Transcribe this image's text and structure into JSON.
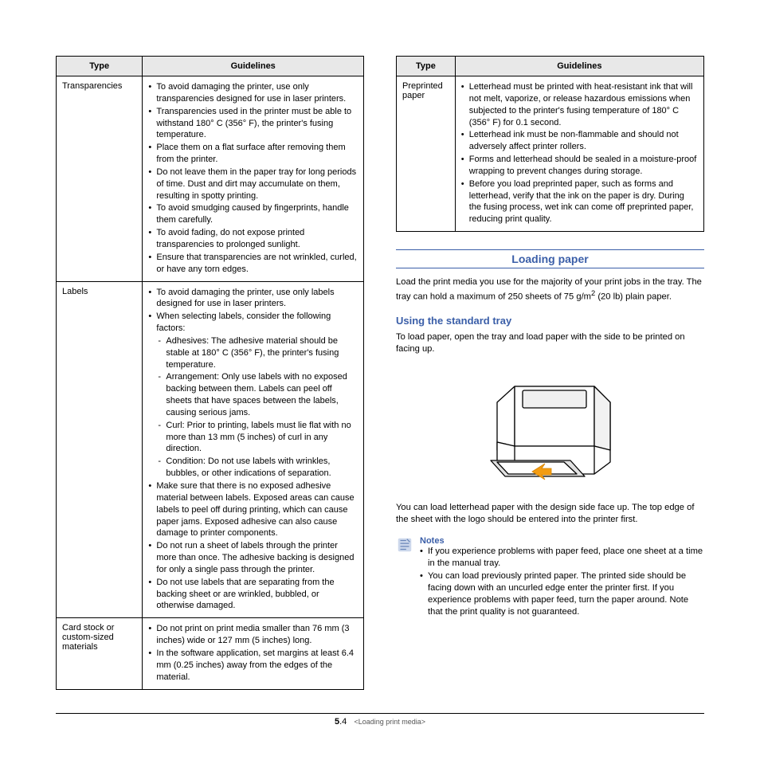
{
  "left_table": {
    "headers": [
      "Type",
      "Guidelines"
    ],
    "rows": [
      {
        "type": "Transparencies",
        "bullets": [
          "To avoid damaging the printer, use only transparencies designed for use in laser printers.",
          "Transparencies used in the printer must be able to withstand 180° C (356° F), the printer's fusing temperature.",
          "Place them on a flat surface after removing them from the printer.",
          "Do not leave them in the paper tray for long periods of time. Dust and dirt may accumulate on them, resulting in spotty printing.",
          "To avoid smudging caused by fingerprints, handle them carefully.",
          "To avoid fading, do not expose printed transparencies to prolonged sunlight.",
          "Ensure that transparencies are not wrinkled, curled, or have any torn edges."
        ]
      },
      {
        "type": "Labels",
        "bullets_pre": [
          "To avoid damaging the printer, use only labels designed for use in laser printers.",
          "When selecting labels, consider the following factors:"
        ],
        "dashes": [
          "Adhesives: The adhesive material should be stable at 180° C (356° F), the printer's fusing temperature.",
          "Arrangement: Only use labels with no exposed backing between them. Labels can peel off sheets that have spaces between the labels, causing serious jams.",
          "Curl: Prior to printing, labels must lie flat with no more than 13 mm (5 inches) of curl in any direction.",
          "Condition: Do not use labels with wrinkles, bubbles, or other indications of separation."
        ],
        "bullets_post": [
          "Make sure that there is no exposed adhesive material between labels. Exposed areas can cause labels to peel off during printing, which can cause paper jams. Exposed adhesive can also cause damage to printer components.",
          "Do not run a sheet of labels through the printer more than once. The adhesive backing is designed for only a single pass through the printer.",
          "Do not use labels that are separating from the backing sheet or are wrinkled, bubbled, or otherwise damaged."
        ]
      },
      {
        "type": "Card stock or custom-sized materials",
        "bullets": [
          "Do not print on print media smaller than 76 mm (3 inches) wide or 127 mm (5 inches) long.",
          "In the software application, set margins at least 6.4 mm (0.25 inches) away from the edges of the material."
        ]
      }
    ]
  },
  "right_table": {
    "headers": [
      "Type",
      "Guidelines"
    ],
    "rows": [
      {
        "type": "Preprinted paper",
        "bullets": [
          "Letterhead must be printed with heat-resistant ink that will not melt, vaporize, or release hazardous emissions when subjected to the printer's fusing temperature of 180° C (356° F) for 0.1 second.",
          "Letterhead ink must be non-flammable and should not adversely affect printer rollers.",
          "Forms and letterhead should be sealed in a moisture-proof wrapping to prevent changes during storage.",
          "Before you load preprinted paper, such as forms and letterhead, verify that the ink on the paper is dry. During the fusing process, wet ink can come off preprinted paper, reducing print quality."
        ]
      }
    ]
  },
  "section_title": "Loading paper",
  "intro_a": "Load the print media you use for the majority of your print jobs in the tray. The tray can hold a maximum of 250 sheets of 75 g/m",
  "intro_b": " (20 lb) plain paper.",
  "subsection": "Using the standard tray",
  "sub_text": "To load paper, open the tray and load paper with the side to be printed on facing up.",
  "after_img": "You can load letterhead paper with the design side face up. The top edge of the sheet with the logo should be entered into the printer first.",
  "notes_title": "Notes",
  "notes": [
    "If you experience problems with paper feed, place one sheet at a time in the manual tray.",
    "You can load previously printed paper. The printed side should be facing down with an uncurled edge enter the printer first. If you experience problems with paper feed, turn the paper around. Note that the print quality is not guaranteed."
  ],
  "footer_page_major": "5",
  "footer_page_minor": ".4",
  "footer_chapter": "<Loading print media>"
}
